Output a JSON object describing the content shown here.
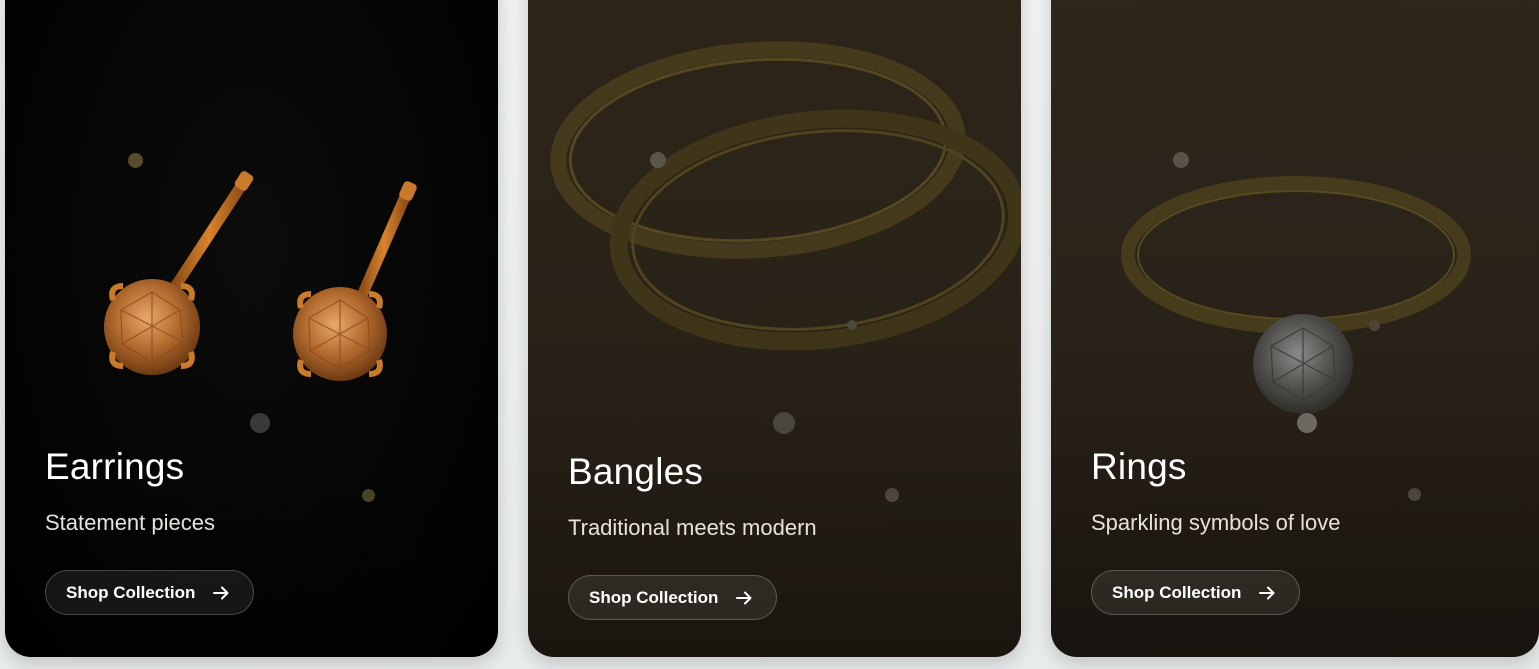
{
  "cards": [
    {
      "title": "Earrings",
      "subtitle": "Statement pieces",
      "button_label": "Shop Collection",
      "button_icon": "arrow-right-icon",
      "image_icon": "earrings-image"
    },
    {
      "title": "Bangles",
      "subtitle": "Traditional meets modern",
      "button_label": "Shop Collection",
      "button_icon": "arrow-right-icon",
      "image_icon": "bangles-image"
    },
    {
      "title": "Rings",
      "subtitle": "Sparkling symbols of love",
      "button_label": "Shop Collection",
      "button_icon": "arrow-right-icon",
      "image_icon": "ring-image"
    }
  ],
  "colors": {
    "card_dark": "#000000",
    "card_warm": "#2a2318",
    "gold": "#c98a3a",
    "text": "#ffffff"
  }
}
